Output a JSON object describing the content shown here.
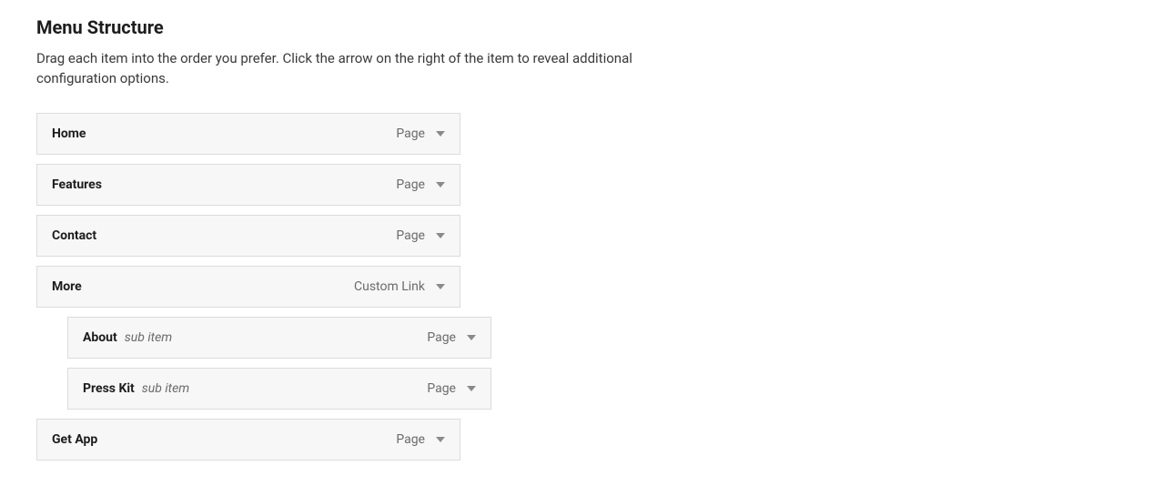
{
  "section": {
    "title": "Menu Structure",
    "description": "Drag each item into the order you prefer. Click the arrow on the right of the item to reveal additional configuration options."
  },
  "sub_item_label": "sub item",
  "menu": [
    {
      "label": "Home",
      "type": "Page",
      "sub": false,
      "children": []
    },
    {
      "label": "Features",
      "type": "Page",
      "sub": false,
      "children": []
    },
    {
      "label": "Contact",
      "type": "Page",
      "sub": false,
      "children": []
    },
    {
      "label": "More",
      "type": "Custom Link",
      "sub": false,
      "children": [
        {
          "label": "About",
          "type": "Page",
          "sub": true
        },
        {
          "label": "Press Kit",
          "type": "Page",
          "sub": true
        }
      ]
    },
    {
      "label": "Get App",
      "type": "Page",
      "sub": false,
      "children": []
    }
  ]
}
